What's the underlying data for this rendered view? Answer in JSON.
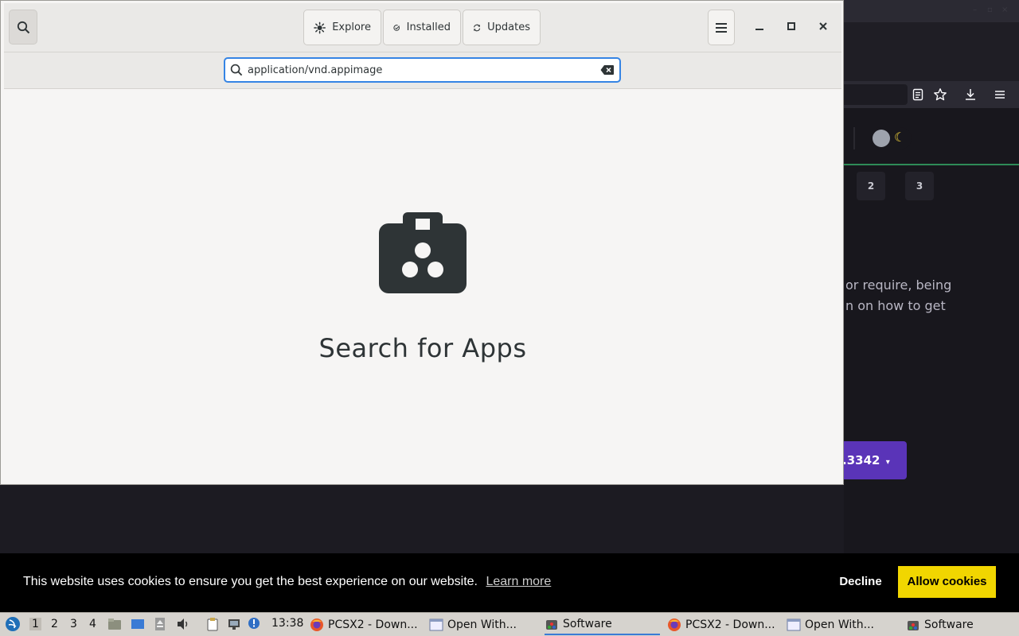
{
  "background_browser": {
    "pagination": [
      "2",
      "3"
    ],
    "paragraph_lines": [
      "or require, being",
      "n on how to get"
    ],
    "download_button": ".3342",
    "icons": [
      "reader-view-icon",
      "bookmark-star-icon",
      "download-icon",
      "hamburger-menu-icon",
      "theme-toggle-icon"
    ]
  },
  "software_window": {
    "tabs": [
      {
        "label": "Explore",
        "icon": "explore-icon"
      },
      {
        "label": "Installed",
        "icon": "installed-check-icon"
      },
      {
        "label": "Updates",
        "icon": "updates-refresh-icon"
      }
    ],
    "search": {
      "value": "application/vnd.appimage"
    },
    "empty_state": {
      "title": "Search for Apps",
      "icon": "software-bag-icon"
    }
  },
  "cookie_banner": {
    "message": "This website uses cookies to ensure you get the best experience on our website.",
    "learn_more": "Learn more",
    "decline": "Decline",
    "allow": "Allow cookies",
    "accent": "#f1d600"
  },
  "taskbar": {
    "workspaces": [
      "1",
      "2",
      "3",
      "4"
    ],
    "clock": "13:38",
    "tasks": [
      {
        "label": "PCSX2 - Down...",
        "icon": "firefox-icon"
      },
      {
        "label": "Open With...",
        "icon": "window-icon"
      },
      {
        "label": "Software",
        "icon": "software-icon"
      },
      {
        "label": "PCSX2 - Down...",
        "icon": "firefox-icon"
      },
      {
        "label": "Open With...",
        "icon": "window-icon"
      },
      {
        "label": "Software",
        "icon": "software-icon"
      }
    ]
  }
}
